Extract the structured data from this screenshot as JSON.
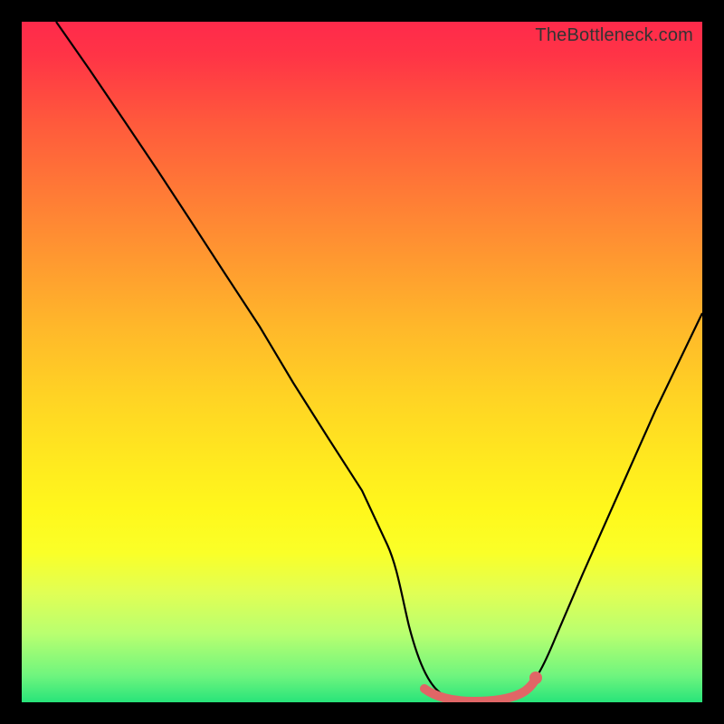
{
  "watermark": "TheBottleneck.com",
  "chart_data": {
    "type": "line",
    "title": "",
    "xlabel": "",
    "ylabel": "",
    "xlim": [
      0,
      100
    ],
    "ylim": [
      0,
      100
    ],
    "x": [
      0,
      5,
      10,
      15,
      20,
      25,
      30,
      35,
      40,
      45,
      50,
      55,
      57,
      60,
      63,
      66,
      69,
      72,
      75,
      80,
      85,
      90,
      95,
      100
    ],
    "values": [
      100,
      93,
      86,
      79,
      71,
      63,
      55,
      47,
      39,
      31,
      23,
      14,
      8,
      3,
      1,
      0,
      0,
      0,
      2,
      9,
      19,
      30,
      41,
      53
    ],
    "valley_range_x": [
      58,
      75
    ],
    "gradient_colors": {
      "top": "#ff2a4b",
      "mid_upper": "#ff9930",
      "mid": "#ffea1f",
      "mid_lower": "#b8ff70",
      "bottom": "#28e47a"
    },
    "annotations": []
  }
}
